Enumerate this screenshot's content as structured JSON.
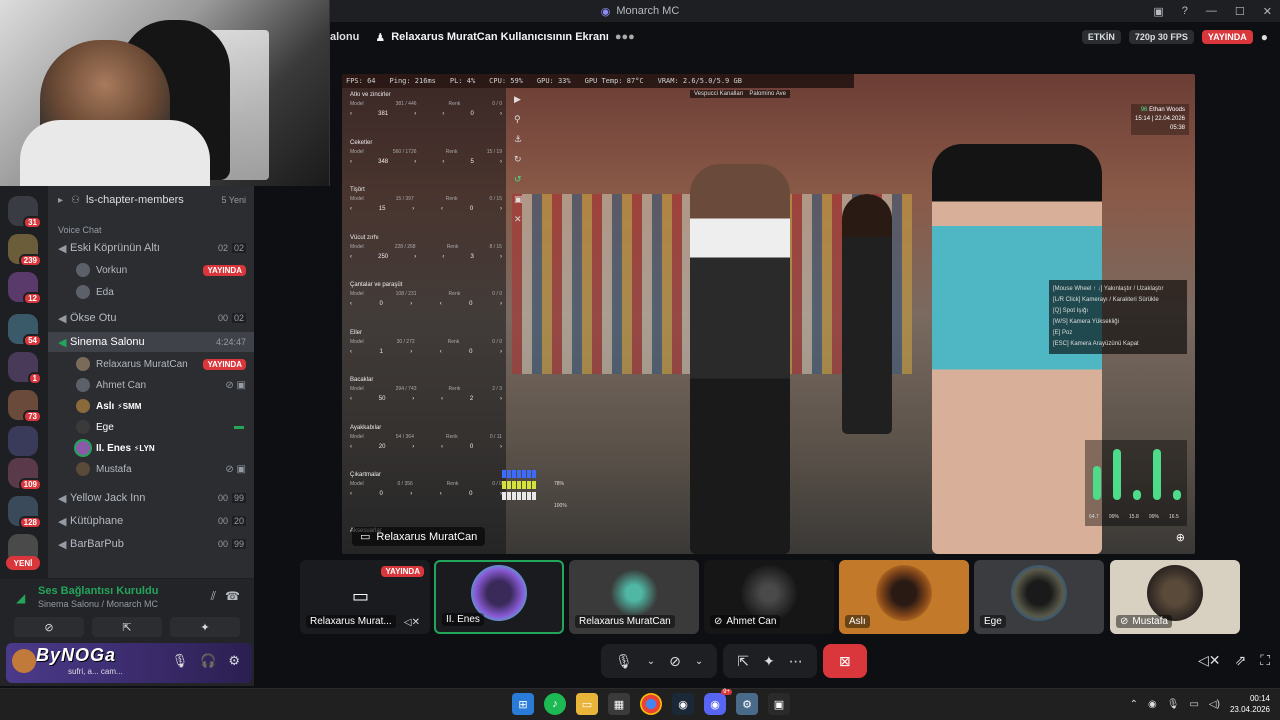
{
  "window": {
    "title": "Monarch MC"
  },
  "stream_header": {
    "channel_label": "alonu",
    "viewer_title": "Relaxarus MuratCan Kullanıcısının Ekranı",
    "active_pill": "ETKİN",
    "quality_pill": "720p 30 FPS",
    "live_pill": "YAYINDA"
  },
  "servers": {
    "badges": [
      "31",
      "239",
      "12",
      "54",
      "1",
      "73",
      "109",
      "128"
    ],
    "new_label": "YENİ"
  },
  "channels": {
    "thread": {
      "name": "ls-chapter-members",
      "count": "5 Yeni"
    },
    "category": "Voice Chat",
    "items": [
      {
        "name": "Eski Köprünün Altı",
        "a": "02",
        "b": "02"
      },
      {
        "name": "Ökse Otu",
        "a": "00",
        "b": "02"
      },
      {
        "name": "Sinema Salonu",
        "timer": "4:24:47"
      },
      {
        "name": "Yellow Jack Inn",
        "a": "00",
        "b": "99"
      },
      {
        "name": "Kütüphane",
        "a": "00",
        "b": "20"
      },
      {
        "name": "BarBarPub",
        "a": "00",
        "b": "99"
      }
    ],
    "eski_users": [
      {
        "name": "Vorkun",
        "live": "YAYINDA"
      },
      {
        "name": "Eda"
      }
    ],
    "sinema_users": [
      {
        "name": "Relaxarus MuratCan",
        "live": "YAYINDA"
      },
      {
        "name": "Ahmet Can"
      },
      {
        "name": "Aslı",
        "tag": "SMM"
      },
      {
        "name": "Ege"
      },
      {
        "name": "II. Enes",
        "tag": "LYN"
      },
      {
        "name": "Mustafa"
      }
    ]
  },
  "voice": {
    "status": "Ses Bağlantısı Kuruldu",
    "sub": "Sinema Salonu / Monarch MC"
  },
  "user_panel": {
    "logo": "ByNOGa",
    "status": "sufri, a... cam..."
  },
  "game": {
    "stats": [
      "FPS: 64",
      "Ping: 216ms",
      "PL: 4%",
      "CPU: 59%",
      "GPU: 33%",
      "GPU Temp: 87°C",
      "VRAM: 2.6/5.0/5.9 GB"
    ],
    "gps": [
      "Vespucci Kanalları",
      "Palomino Ave"
    ],
    "hud": {
      "name": "Ethan Woods",
      "level": "96",
      "time": "15:14",
      "date": "22.04.2026",
      "clock": "05:38"
    },
    "menu": [
      {
        "title": "Atkı ve zincirler",
        "model": "381 / 446",
        "renk": "0 / 0",
        "v1": "381",
        "v2": "0"
      },
      {
        "title": "Ceketler",
        "model": "560 / 1726",
        "renk": "15 / 19",
        "v1": "348",
        "v2": "5"
      },
      {
        "title": "Tişört",
        "model": "15 / 397",
        "renk": "0 / 15",
        "v1": "15",
        "v2": "0"
      },
      {
        "title": "Vücut zırhı",
        "model": "228 / 268",
        "renk": "8 / 15",
        "v1": "250",
        "v2": "3"
      },
      {
        "title": "Çantalar ve paraşüt",
        "model": "108 / 231",
        "renk": "0 / 0",
        "v1": "0",
        "v2": "0"
      },
      {
        "title": "Eller",
        "model": "30 / 272",
        "renk": "0 / 0",
        "v1": "1",
        "v2": "0"
      },
      {
        "title": "Bacaklar",
        "model": "294 / 743",
        "renk": "2 / 3",
        "v1": "50",
        "v2": "2"
      },
      {
        "title": "Ayakkabılar",
        "model": "54 / 364",
        "renk": "0 / 11",
        "v1": "20",
        "v2": "0"
      },
      {
        "title": "Çıkartmalar",
        "model": "0 / 356",
        "renk": "0 / 0",
        "v1": "0",
        "v2": "0"
      }
    ],
    "menu_last": "Aksesuarlar",
    "model_label": "Model",
    "renk_label": "Renk",
    "help": [
      "[Mouse Wheel ↑ ↓] Yakınlaştır / Uzaklaştır",
      "[L/R Click] Kamerayı / Karakteri Sürükle",
      "[Q] Spot Işığı",
      "[W/S] Kamera Yüksekliği",
      "[E] Poz",
      "[ESC] Kamera Arayüzünü Kapat"
    ],
    "meters": [
      {
        "value": "64.7",
        "level": 0.65
      },
      {
        "value": "99%",
        "level": 0.99
      },
      {
        "value": "15.8",
        "level": 0.2
      },
      {
        "value": "99%",
        "level": 0.99
      },
      {
        "value": "16.5",
        "level": 0.2
      }
    ],
    "bars": [
      {
        "value": "",
        "color": "#3b6cff"
      },
      {
        "value": "",
        "color": "#d6e23a"
      },
      {
        "value": "100%",
        "color": "#e8e8e8"
      }
    ],
    "bar_labels": [
      "78%",
      "100%"
    ],
    "stream_owner": "Relaxarus MuratCan"
  },
  "tiles": [
    {
      "name": "Relaxarus Murat...",
      "live": "YAYINDA"
    },
    {
      "name": "II. Enes"
    },
    {
      "name": "Relaxarus MuratCan"
    },
    {
      "name": "Ahmet Can"
    },
    {
      "name": "Aslı"
    },
    {
      "name": "Ege"
    },
    {
      "name": "Mustafa"
    }
  ],
  "taskbar": {
    "time": "00:14",
    "date": "23.04.2026",
    "discord_badge": "9+"
  },
  "colors": {
    "discord_red": "#da373c",
    "discord_green": "#23a55a",
    "meter_green": "#4ddc8a"
  }
}
